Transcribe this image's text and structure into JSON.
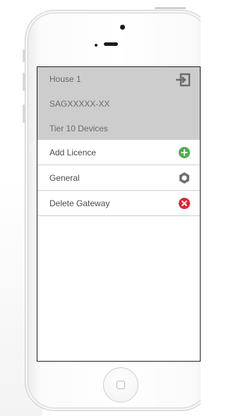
{
  "header": {
    "house_name": "House 1",
    "gateway_id": "SAGXXXXX-XX",
    "tier": "Tier 10 Devices",
    "logout_icon": "logout-icon"
  },
  "menu": {
    "items": [
      {
        "label": "Add Licence",
        "icon": "add-circle-icon",
        "color": "#4cae4c"
      },
      {
        "label": "General",
        "icon": "gear-icon",
        "color": "#6e6e6e"
      },
      {
        "label": "Delete Gateway",
        "icon": "delete-circle-icon",
        "color": "#e0242f"
      }
    ]
  },
  "colors": {
    "header_bg": "#cdcdcd",
    "text": "#4a4a4a"
  }
}
